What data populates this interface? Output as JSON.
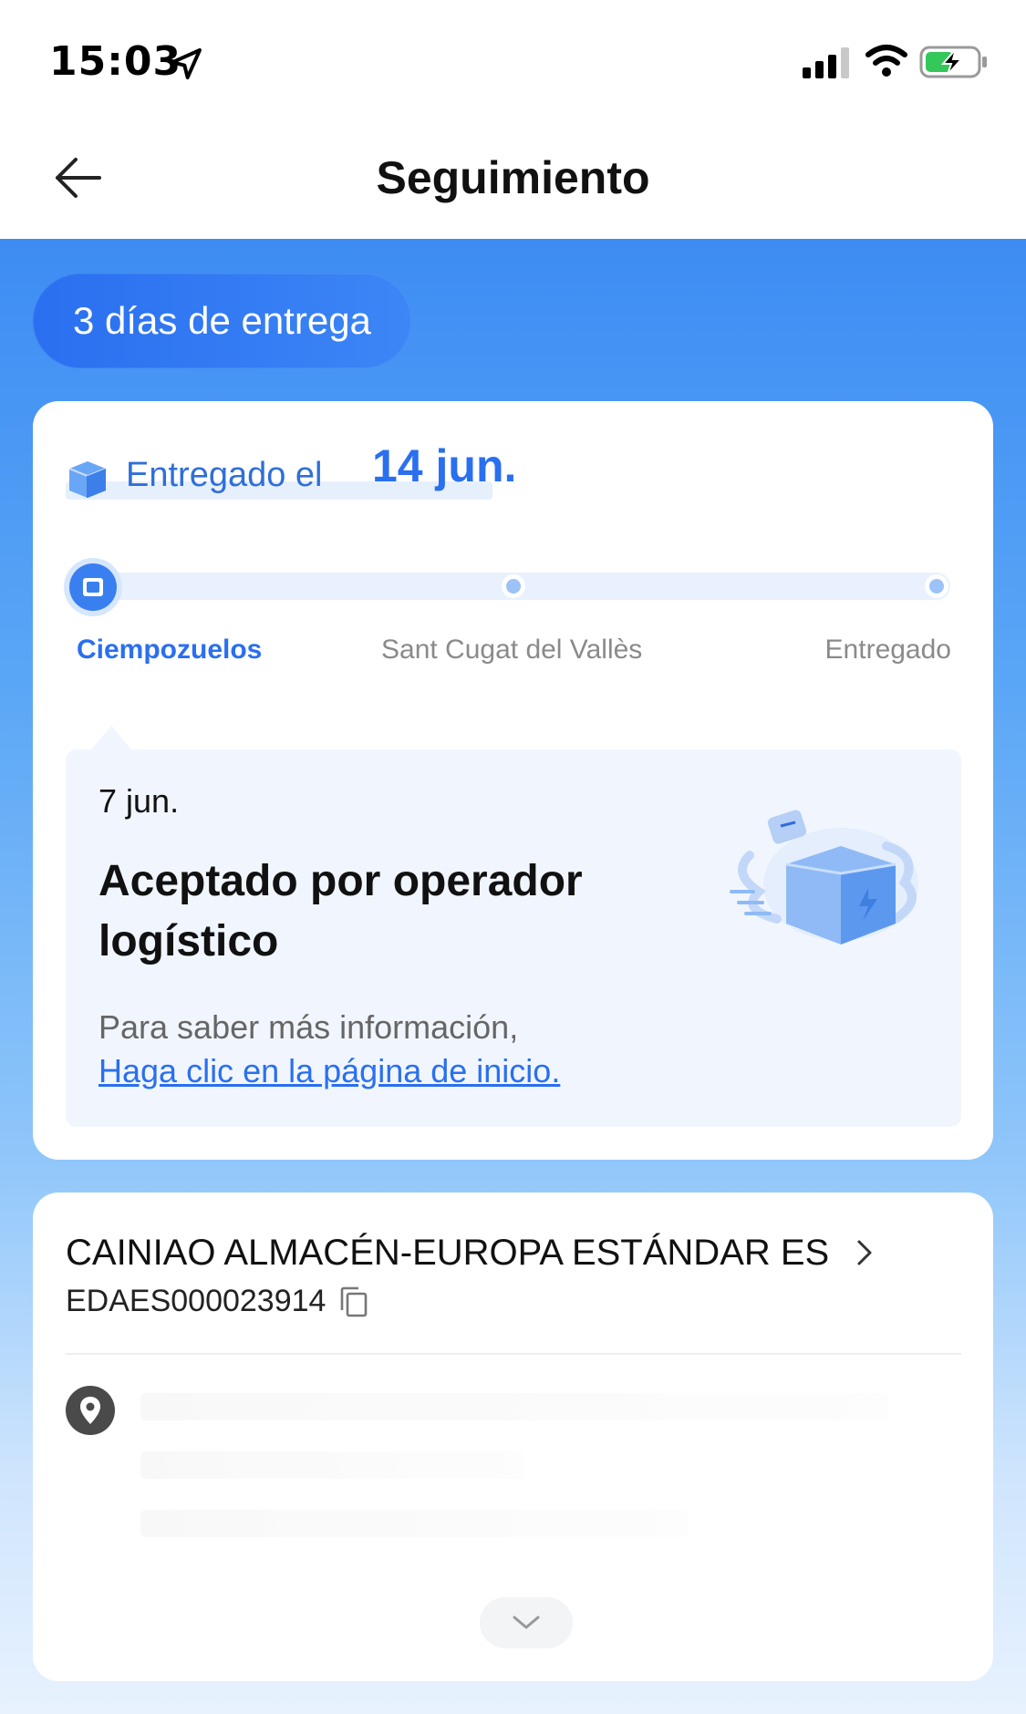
{
  "status_bar": {
    "time": "15:03",
    "icons": [
      "location-arrow-icon",
      "cellular-signal-icon",
      "wifi-icon",
      "battery-charging-icon"
    ]
  },
  "nav": {
    "title": "Seguimiento",
    "back_icon": "arrow-left-icon"
  },
  "colors": {
    "accent": "#2a6ff0",
    "hero_gradient_top": "#3d8cf3",
    "hero_gradient_bottom": "#e8f2fe",
    "battery_green": "#34c759"
  },
  "delivery_badge": "3 días de entrega",
  "delivery": {
    "label": "Entregado el",
    "date": "14 jun."
  },
  "progress": {
    "stops": [
      "Ciempozuelos",
      "Sant Cugat del Vallès",
      "Entregado"
    ],
    "current_index": 0
  },
  "latest_event": {
    "date": "7 jun.",
    "title": "Aceptado por operador logístico",
    "info": "Para saber más información,",
    "link": "Haga clic en la página de inicio."
  },
  "carrier": {
    "name": "CAINIAO ALMACÉN-EUROPA ESTÁNDAR ES",
    "tracking_number": "EDAES000023914"
  }
}
